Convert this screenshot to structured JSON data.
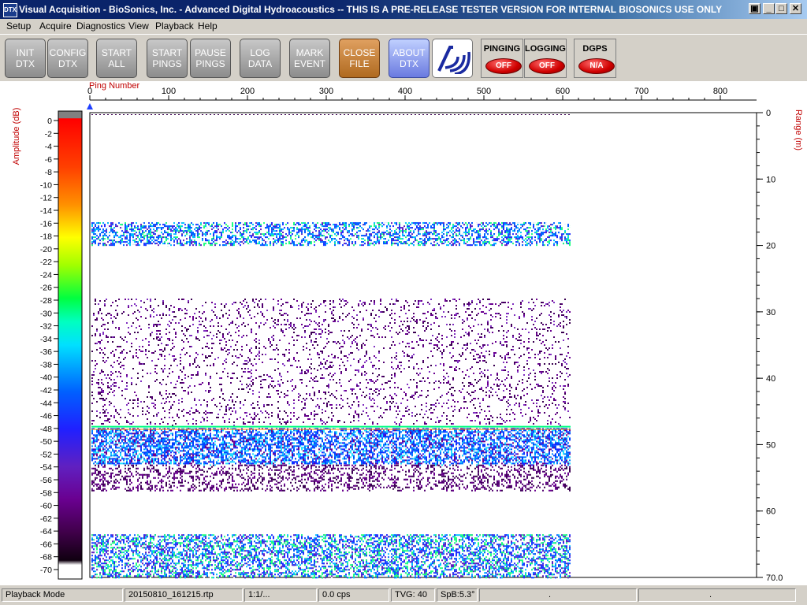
{
  "window": {
    "app_icon": "DTX",
    "title": "Visual Acquisition  -  BioSonics, Inc.  -  Advanced Digital Hydroacoustics  -- THIS IS A PRE-RELEASE TESTER VERSION FOR INTERNAL BIOSONICS USE ONLY",
    "controls": {
      "restore": "▣",
      "minimize": "_",
      "maximize": "□",
      "close": "✕"
    }
  },
  "menu": [
    "Setup",
    "Acquire",
    "Diagnostics",
    "View",
    "Playback",
    "Help"
  ],
  "toolbar": {
    "buttons": [
      {
        "line1": "INIT",
        "line2": "DTX",
        "style": "gray"
      },
      {
        "line1": "CONFIG",
        "line2": "DTX",
        "style": "gray"
      },
      {
        "line1": "START",
        "line2": "ALL",
        "style": "gray"
      },
      {
        "line1": "START",
        "line2": "PINGS",
        "style": "gray"
      },
      {
        "line1": "PAUSE",
        "line2": "PINGS",
        "style": "gray"
      },
      {
        "line1": "LOG",
        "line2": "DATA",
        "style": "gray"
      },
      {
        "line1": "MARK",
        "line2": "EVENT",
        "style": "gray"
      },
      {
        "line1": "CLOSE",
        "line2": "FILE",
        "style": "orange"
      },
      {
        "line1": "ABOUT",
        "line2": "DTX",
        "style": "blue"
      }
    ],
    "logo_icon": "biosonics-logo-icon",
    "indicators": [
      {
        "label": "PINGING",
        "state": "OFF"
      },
      {
        "label": "LOGGING",
        "state": "OFF"
      },
      {
        "label": "DGPS",
        "state": "N/A"
      }
    ]
  },
  "echogram": {
    "x_axis_label": "Ping Number",
    "y_axis_label": "Range (m)",
    "x_ticks": [
      "0",
      "100",
      "200",
      "300",
      "400",
      "500",
      "600",
      "700",
      "800"
    ],
    "y_ticks": [
      "0",
      "10",
      "20",
      "30",
      "40",
      "50",
      "60",
      "70.0"
    ],
    "x_range": [
      0,
      850
    ],
    "y_range": [
      0,
      70
    ],
    "data_end_ping": 610,
    "color_scale": {
      "label": "Amplitude (dB)",
      "ticks": [
        "0",
        "-2",
        "-4",
        "-6",
        "-8",
        "-10",
        "-12",
        "-14",
        "-16",
        "-18",
        "-20",
        "-22",
        "-24",
        "-26",
        "-28",
        "-30",
        "-32",
        "-34",
        "-36",
        "-38",
        "-40",
        "-42",
        "-44",
        "-46",
        "-48",
        "-50",
        "-52",
        "-54",
        "-56",
        "-58",
        "-60",
        "-62",
        "-64",
        "-66",
        "-68",
        "-70"
      ],
      "range_db": [
        -70,
        0
      ]
    },
    "layers_m": [
      {
        "name": "surface-noise-band",
        "top": 16.5,
        "bottom": 20.0
      },
      {
        "name": "scatter-layer",
        "top": 28.0,
        "bottom": 47.0
      },
      {
        "name": "bottom-echo",
        "top": 47.5,
        "bottom": 53.0
      },
      {
        "name": "bottom-reverb",
        "top": 53.0,
        "bottom": 57.0
      },
      {
        "name": "second-bottom",
        "top": 63.5,
        "bottom": 70.0
      }
    ]
  },
  "status": {
    "mode": "Playback Mode",
    "file": "20150810_161215.rtp",
    "ratio": "1:1/...",
    "rate": "0.0 cps",
    "tvg": "TVG: 40",
    "spb": "SpB:5.3°",
    "extra1": ".",
    "extra2": "."
  }
}
